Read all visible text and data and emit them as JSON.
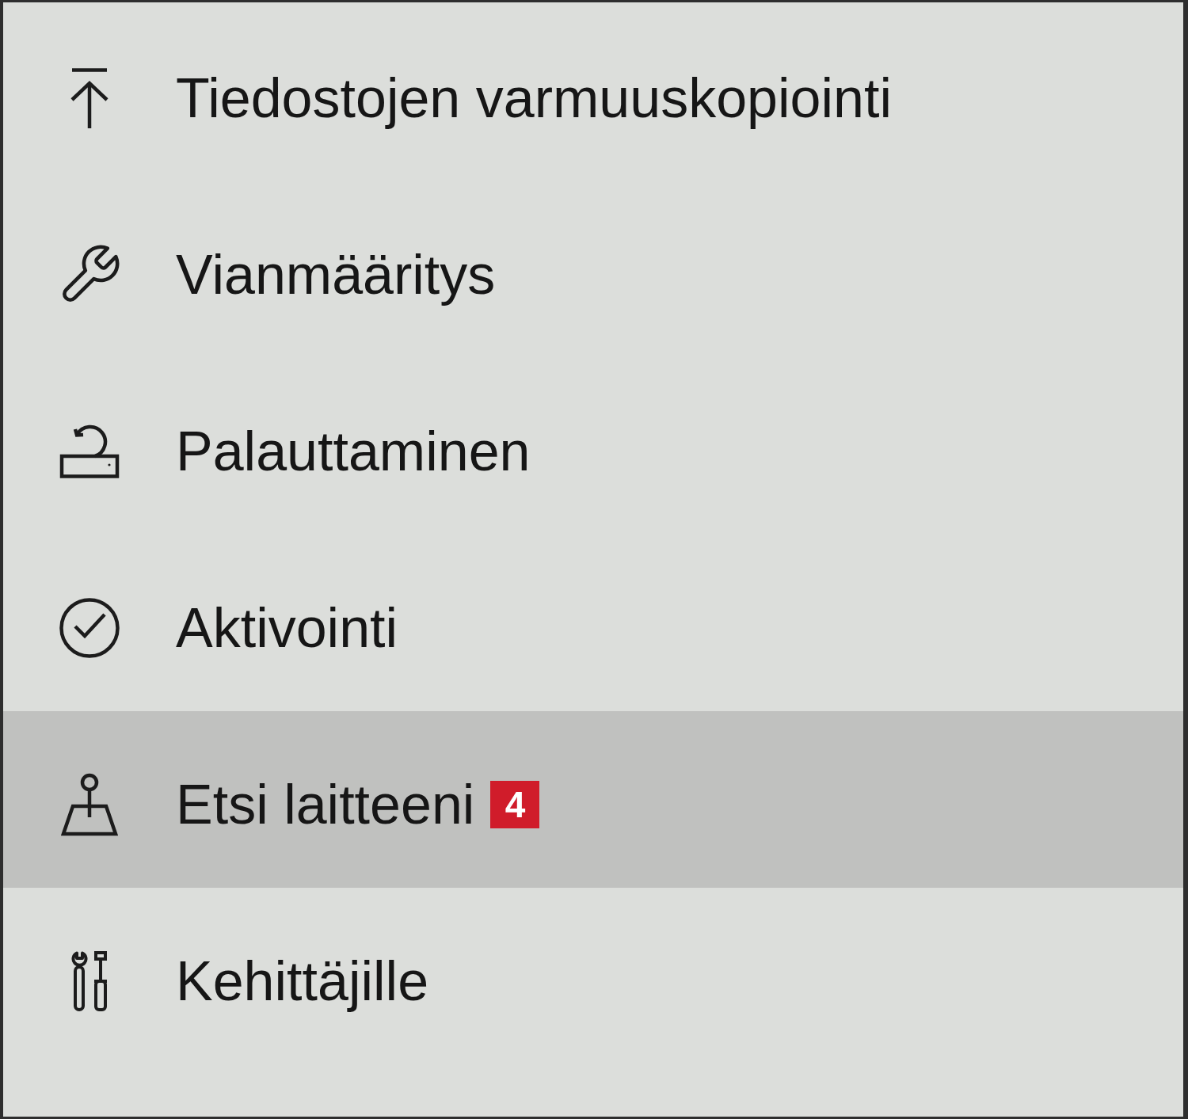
{
  "menu": {
    "items": [
      {
        "label": "Tiedostojen varmuuskopiointi",
        "selected": false
      },
      {
        "label": "Vianmääritys",
        "selected": false
      },
      {
        "label": "Palauttaminen",
        "selected": false
      },
      {
        "label": "Aktivointi",
        "selected": false
      },
      {
        "label": "Etsi laitteeni",
        "selected": true,
        "badge": "4"
      },
      {
        "label": "Kehittäjille",
        "selected": false
      }
    ]
  }
}
